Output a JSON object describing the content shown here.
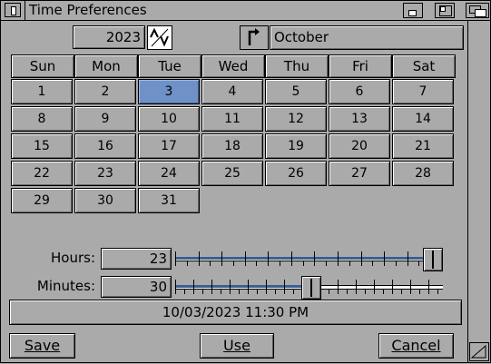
{
  "window": {
    "title": "Time Preferences"
  },
  "year": "2023",
  "month": "October",
  "weekdays": [
    "Sun",
    "Mon",
    "Tue",
    "Wed",
    "Thu",
    "Fri",
    "Sat"
  ],
  "days": [
    "1",
    "2",
    "3",
    "4",
    "5",
    "6",
    "7",
    "8",
    "9",
    "10",
    "11",
    "12",
    "13",
    "14",
    "15",
    "16",
    "17",
    "18",
    "19",
    "20",
    "21",
    "22",
    "23",
    "24",
    "25",
    "26",
    "27",
    "28",
    "29",
    "30",
    "31"
  ],
  "selected_day": "3",
  "hours": {
    "label": "Hours:",
    "value": "23",
    "max": 23
  },
  "minutes": {
    "label": "Minutes:",
    "value": "30",
    "max": 59
  },
  "status": "10/03/2023 11:30 PM",
  "buttons": {
    "save_label": "Save",
    "use_label": "Use",
    "cancel_label": "Cancel"
  },
  "icons": {
    "close": "close-icon",
    "iconify": "iconify-icon",
    "zoom": "zoom-icon",
    "depth": "depth-icon",
    "year_stepper": "up-down-arrow-icon",
    "month_cycle": "cycle-icon",
    "resize": "resize-icon"
  }
}
